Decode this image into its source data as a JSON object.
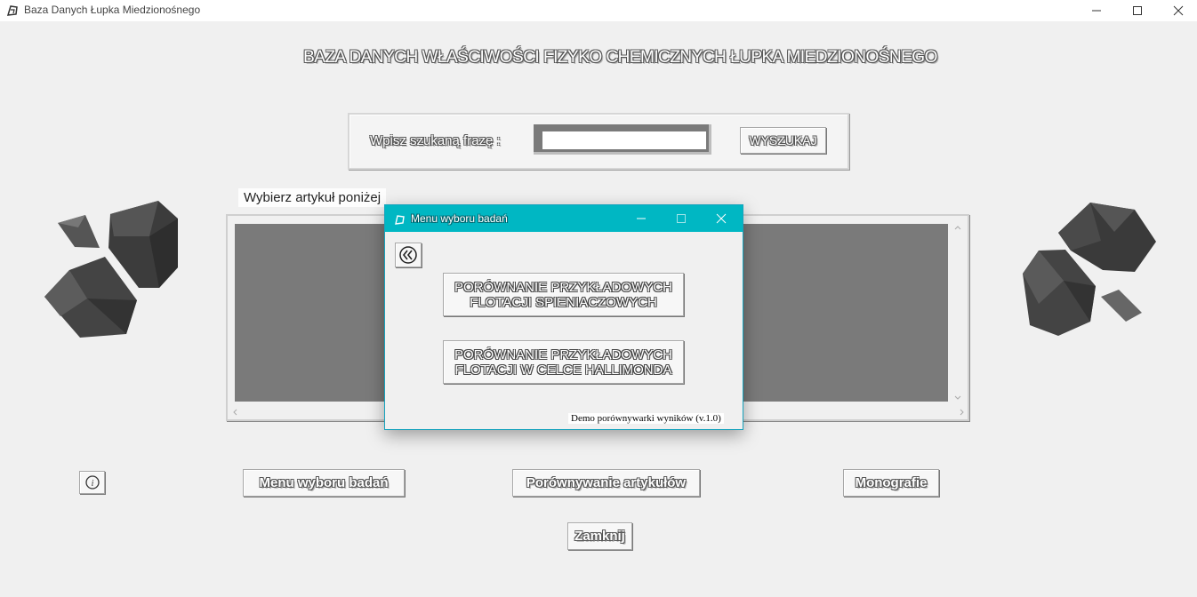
{
  "window": {
    "title": "Baza Danych Łupka Miedzionośnego",
    "controls": [
      "minimize-icon",
      "maximize-icon",
      "close-icon"
    ]
  },
  "main_title": "BAZA DANYCH WŁAŚCIWOŚCI FIZYKO CHEMICZNYCH ŁUPKA MIEDZIONOŚNEGO",
  "search": {
    "label": "Wpisz szukaną frazę :",
    "value": "",
    "button_label": "WYSZUKAJ"
  },
  "articles": {
    "label": "Wybierz artykuł poniżej",
    "items": []
  },
  "bottom": {
    "info_icon": "info-icon",
    "menu_label": "Menu wyboru badań",
    "compare_label": "Porównywanie artykułów",
    "mono_label": "Monografie",
    "close_label": "Zamknij"
  },
  "dialog": {
    "title": "Menu wyboru badań",
    "back_icon": "double-chevron-left-icon",
    "option1": "PORÓWNANIE PRZYKŁADOWYCH FLOTACJI SPIENIACZOWYCH",
    "option2": "PORÓWNANIE PRZYKŁADOWYCH FLOTACJI W CELCE HALLIMONDA",
    "footer": "Demo porównywarki wyników (v.1.0)"
  },
  "colors": {
    "dialog_titlebar": "#00b7c3",
    "list_background": "#7a7a7a",
    "window_background": "#f0f0f0"
  }
}
